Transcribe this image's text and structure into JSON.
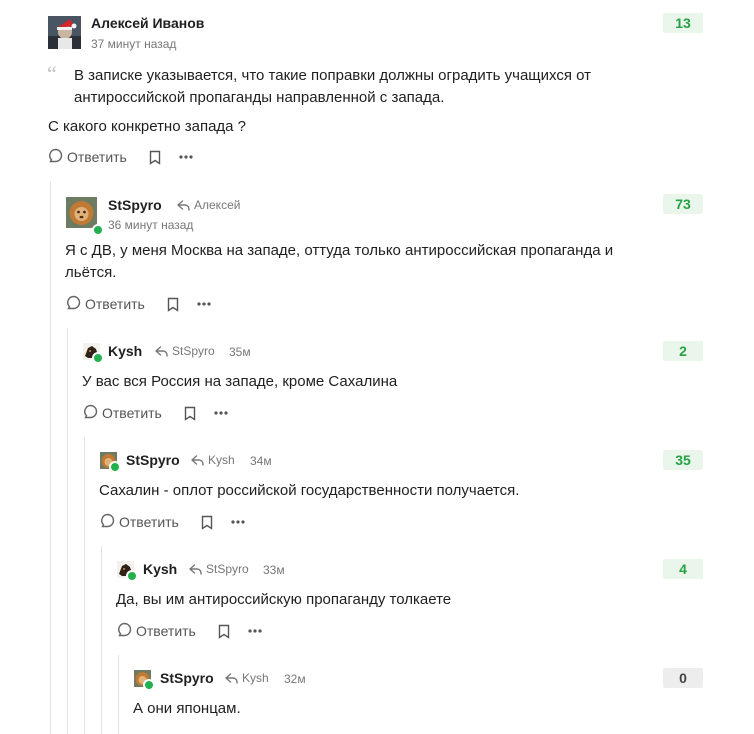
{
  "comments": [
    {
      "author": "Алексей Иванов",
      "time": "37 минут назад",
      "score": "13",
      "quote": "В записке указывается, что такие поправки должны оградить учащихся от антироссийской пропаганды направленной с запада.",
      "text": "С какого конкретно запада ?",
      "reply_label": "Ответить"
    },
    {
      "author": "StSpyro",
      "reply_to": "Алексей",
      "time": "36 минут назад",
      "score": "73",
      "text": "Я с ДВ, у меня Москва на западе, оттуда только антироссийская пропаганда и льётся.",
      "reply_label": "Ответить"
    },
    {
      "author": "Kysh",
      "reply_to": "StSpyro",
      "time": "35м",
      "score": "2",
      "text": "У вас вся Россия на западе, кроме Сахалина",
      "reply_label": "Ответить"
    },
    {
      "author": "StSpyro",
      "reply_to": "Kysh",
      "time": "34м",
      "score": "35",
      "text": "Сахалин - оплот российской государственности получается.",
      "reply_label": "Ответить"
    },
    {
      "author": "Kysh",
      "reply_to": "StSpyro",
      "time": "33м",
      "score": "4",
      "text": "Да, вы им антироссийскую пропаганду толкаете",
      "reply_label": "Ответить"
    },
    {
      "author": "StSpyro",
      "reply_to": "Kysh",
      "time": "32м",
      "score": "0",
      "text": "А они японцам."
    }
  ],
  "colors": {
    "score_positive": "#25a244",
    "score_positive_bg": "#eaf6ec",
    "score_zero_bg": "#ededed",
    "online": "#22b14c"
  }
}
